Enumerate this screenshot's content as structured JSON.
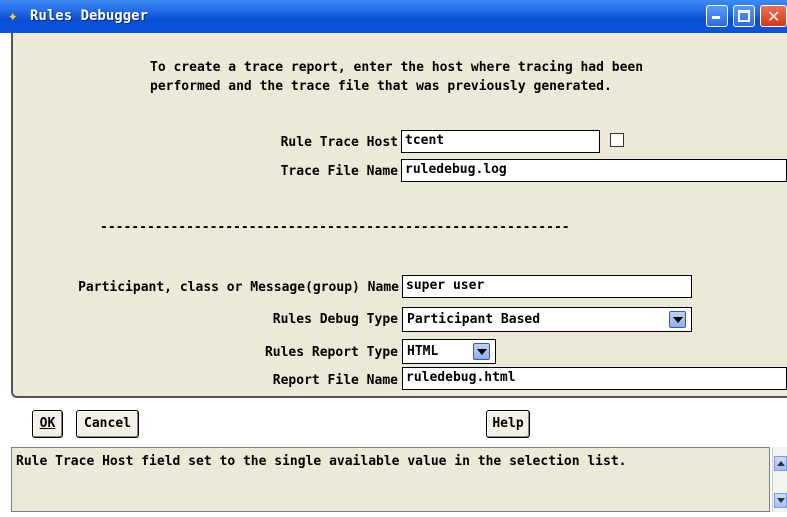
{
  "window": {
    "title": "Rules Debugger",
    "app_icon": "rules-debugger-icon",
    "controls": [
      "minimize-icon",
      "maximize-icon",
      "close-icon"
    ]
  },
  "description": {
    "line1": "To create a trace report, enter the host where tracing had been",
    "line2": "performed and the trace file that was previously generated."
  },
  "trace": {
    "host_label": "Rule Trace Host",
    "host_value": "tcent",
    "host_checked": false,
    "file_label": "Trace File Name",
    "file_value": "ruledebug.log"
  },
  "separator": "------------------------------------------------------------",
  "debug": {
    "name_label": "Participant, class or Message(group) Name",
    "name_value": "super user",
    "type_label": "Rules Debug Type",
    "type_value": "Participant Based",
    "report_type_label": "Rules Report Type",
    "report_type_value": "HTML",
    "report_file_label": "Report File Name",
    "report_file_value": "ruledebug.html"
  },
  "buttons": {
    "ok": "OK",
    "cancel": "Cancel",
    "help": "Help"
  },
  "status_message": "Rule Trace Host field set to the single available value in the selection list."
}
